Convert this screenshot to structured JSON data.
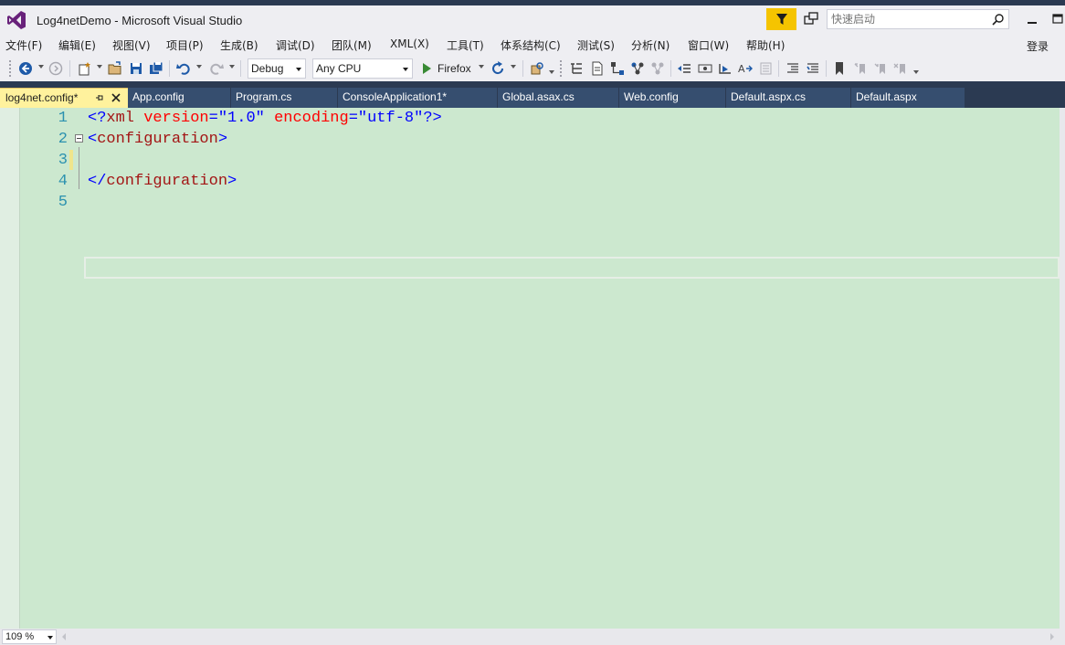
{
  "window": {
    "title": "Log4netDemo - Microsoft Visual Studio",
    "quick_launch_placeholder": "快速启动",
    "login": "登录"
  },
  "menu": [
    {
      "label": "文件(F)"
    },
    {
      "label": "编辑(E)"
    },
    {
      "label": "视图(V)"
    },
    {
      "label": "项目(P)"
    },
    {
      "label": "生成(B)"
    },
    {
      "label": "调试(D)"
    },
    {
      "label": "团队(M)"
    },
    {
      "label": "XML(X)"
    },
    {
      "label": "工具(T)"
    },
    {
      "label": "体系结构(C)"
    },
    {
      "label": "测试(S)"
    },
    {
      "label": "分析(N)"
    },
    {
      "label": "窗口(W)"
    },
    {
      "label": "帮助(H)"
    }
  ],
  "toolbar": {
    "configuration": "Debug",
    "platform": "Any CPU",
    "run_target": "Firefox"
  },
  "tabs": {
    "active": "log4net.config*",
    "others": [
      {
        "label": "App.config"
      },
      {
        "label": "Program.cs"
      },
      {
        "label": "ConsoleApplication1*"
      },
      {
        "label": "Global.asax.cs"
      },
      {
        "label": "Web.config"
      },
      {
        "label": "Default.aspx.cs"
      },
      {
        "label": "Default.aspx"
      }
    ]
  },
  "editor": {
    "lines": [
      {
        "num": "1",
        "t1": "<?",
        "t2": "xml",
        "t3": " ",
        "t4": "version",
        "t5": "=",
        "t6": "\"1.0\"",
        "t7": " ",
        "t8": "encoding",
        "t9": "=",
        "t10": "\"utf-8\"",
        "t11": "?>"
      },
      {
        "num": "2",
        "t1": "<",
        "t2": "configuration",
        "t3": ">"
      },
      {
        "num": "3"
      },
      {
        "num": "4",
        "t1": "</",
        "t2": "configuration",
        "t3": ">"
      },
      {
        "num": "5"
      }
    ],
    "zoom": "109 %"
  },
  "colors": {
    "accent_filter": "#f5c400",
    "tab_active": "#fff29d",
    "tab_inactive": "#364e6f",
    "editor_bg": "#cce8cf"
  }
}
